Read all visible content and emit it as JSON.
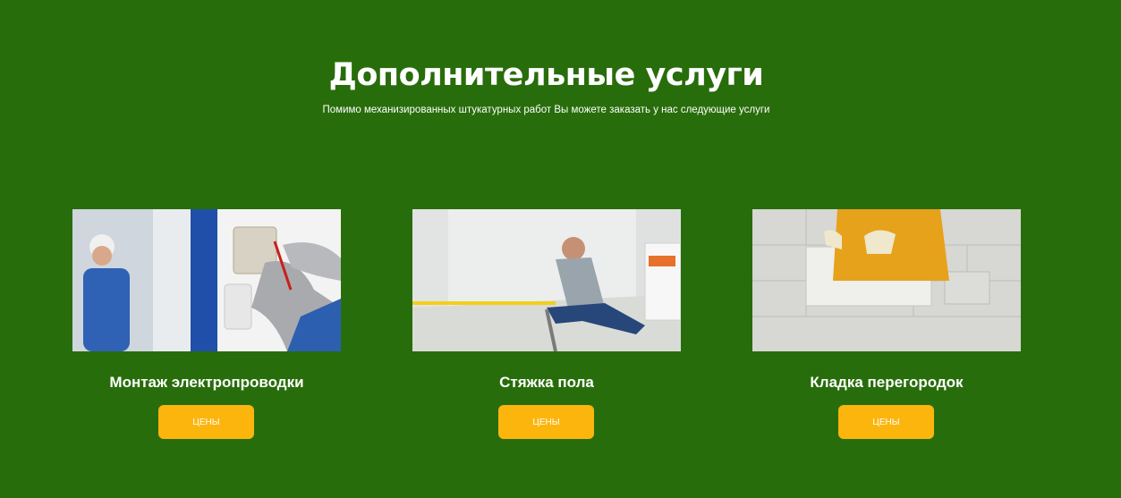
{
  "section": {
    "title": "Дополнительные услуги",
    "subtitle": "Помимо механизированных штукатурных работ Вы можете заказать у нас следующие услуги"
  },
  "services": [
    {
      "title": "Монтаж электропроводки",
      "button_label": "ЦЕНЫ",
      "image": "electrician-wiring-photo"
    },
    {
      "title": "Стяжка пола",
      "button_label": "ЦЕНЫ",
      "image": "floor-screed-photo"
    },
    {
      "title": "Кладка перегородок",
      "button_label": "ЦЕНЫ",
      "image": "block-wall-photo"
    }
  ],
  "colors": {
    "background": "#286d0b",
    "button": "#fbb50d",
    "text": "#ffffff"
  }
}
